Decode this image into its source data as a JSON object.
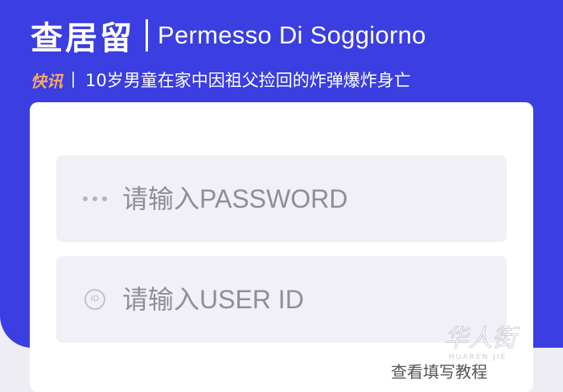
{
  "header": {
    "title": "查居留",
    "subtitle": "Permesso Di Soggiorno"
  },
  "news": {
    "tag": "快讯",
    "text": "10岁男童在家中因祖父捡回的炸弹爆炸身亡"
  },
  "form": {
    "password_placeholder": "请输入PASSWORD",
    "password_value": "",
    "password_icon": "dots-icon",
    "userid_placeholder": "请输入USER ID",
    "userid_value": "",
    "userid_icon": "id-badge-icon",
    "userid_icon_text": "ID"
  },
  "links": {
    "tutorial": "查看填写教程"
  },
  "watermark": {
    "text": "华人街",
    "latin": "HUAREN JIE"
  },
  "colors": {
    "hero_blue": "#3b3ee0",
    "news_tag": "#f3a76a",
    "page_bg": "#ededf3",
    "field_bg": "#f0f0f6"
  }
}
